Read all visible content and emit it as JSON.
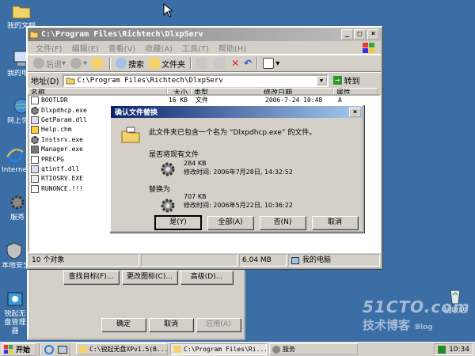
{
  "desktop": {
    "icons": [
      {
        "label": "我的文档",
        "name": "my-documents"
      },
      {
        "label": "我的电脑",
        "name": "my-computer"
      },
      {
        "label": "网上邻居",
        "name": "network-places"
      },
      {
        "label": "Internet Explorer",
        "name": "internet-explorer"
      },
      {
        "label": "服务",
        "name": "services"
      },
      {
        "label": "本地安全",
        "name": "local-security"
      },
      {
        "label": "锐起无盘管理器",
        "name": "richtech-manager"
      }
    ],
    "recycle_label": "回收站"
  },
  "explorer": {
    "title": "C:\\Program Files\\Richtech\\DlxpServ",
    "menu": [
      "文件(F)",
      "编辑(E)",
      "查看(V)",
      "收藏(A)",
      "工具(T)",
      "帮助(H)"
    ],
    "toolbar": {
      "back": "后退",
      "search": "搜索",
      "folders": "文件夹"
    },
    "address_label": "地址(D)",
    "address_value": "C:\\Program Files\\Richtech\\DlxpServ",
    "go_label": "转到",
    "columns": [
      "名称",
      "大小",
      "类型",
      "修改日期",
      "属性"
    ],
    "rows": [
      {
        "name": "BOOTLDR",
        "size": "16 KB",
        "type": "文件",
        "date": "2006-7-24 10:48",
        "attr": "A",
        "icon": "file"
      },
      {
        "name": "Dlxpdhcp.exe",
        "size": "",
        "type": "",
        "date": "",
        "attr": "",
        "icon": "gear"
      },
      {
        "name": "GetParam.dll",
        "size": "",
        "type": "",
        "date": "",
        "attr": "",
        "icon": "dll"
      },
      {
        "name": "Help.chm",
        "size": "",
        "type": "",
        "date": "",
        "attr": "",
        "icon": "help"
      },
      {
        "name": "Instsrv.exe",
        "size": "",
        "type": "",
        "date": "",
        "attr": "",
        "icon": "gear"
      },
      {
        "name": "Manager.exe",
        "size": "",
        "type": "",
        "date": "",
        "attr": "",
        "icon": "app"
      },
      {
        "name": "PRECPG",
        "size": "",
        "type": "",
        "date": "",
        "attr": "",
        "icon": "file"
      },
      {
        "name": "qtintf.dll",
        "size": "",
        "type": "",
        "date": "",
        "attr": "",
        "icon": "dll"
      },
      {
        "name": "RTIOSRV.EXE",
        "size": "",
        "type": "",
        "date": "",
        "attr": "",
        "icon": "exe"
      },
      {
        "name": "RUNONCE.!!!",
        "size": "",
        "type": "",
        "date": "",
        "attr": "",
        "icon": "file"
      }
    ],
    "status": {
      "count": "10 个对象",
      "size": "6.04 MB",
      "location": "我的电脑"
    }
  },
  "dialog": {
    "title": "确认文件替换",
    "message": "此文件夹已包含一个名为 “Dlxpdhcp.exe” 的文件。",
    "question": "是否将现有文件",
    "existing_size": "284 KB",
    "existing_time": "修改时间: 2006年7月28日, 14:32:52",
    "replace_with": "替换为",
    "new_size": "707 KB",
    "new_time": "修改时间: 2006年5月22日, 10:36:22",
    "buttons": {
      "yes": "是(Y)",
      "yes_all": "全部(A)",
      "no": "否(N)",
      "cancel": "取消"
    }
  },
  "back_window": {
    "buttons": {
      "find": "查找目标(F)...",
      "change_icon": "更改图标(C)...",
      "advanced": "高级(D)..."
    },
    "ok": "确定",
    "cancel": "取消",
    "apply": "应用(A)"
  },
  "taskbar": {
    "start": "开始",
    "tasks": [
      "C:\\锐起无盘XPv1.5(B...",
      "C:\\Program Files\\Ri...",
      "服务"
    ],
    "clock": "10:34"
  },
  "watermark": {
    "line1": "51CTO.com",
    "line2": "技术博客",
    "line3": "Blog"
  }
}
